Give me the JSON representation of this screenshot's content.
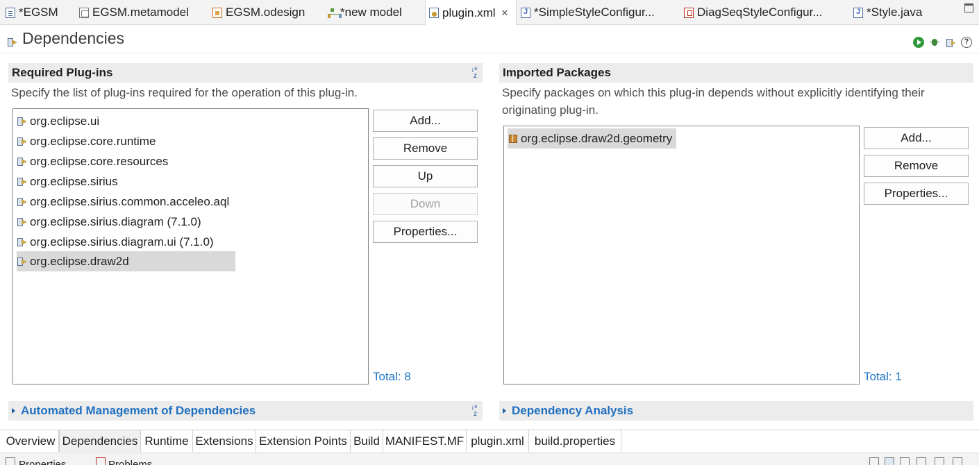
{
  "editor_tabs": [
    {
      "label": "*EGSM",
      "icon": "model-file-icon",
      "active": false
    },
    {
      "label": "EGSM.metamodel",
      "icon": "metamodel-file-icon",
      "active": false
    },
    {
      "label": "EGSM.odesign",
      "icon": "odesign-file-icon",
      "active": false
    },
    {
      "label": "*new model",
      "icon": "model-tree-icon",
      "active": false
    },
    {
      "label": "plugin.xml",
      "icon": "plugin-xml-icon",
      "active": true,
      "close": "✕"
    },
    {
      "label": "*SimpleStyleConfigur...",
      "icon": "java-file-icon",
      "active": false
    },
    {
      "label": "DiagSeqStyleConfigur...",
      "icon": "java-error-file-icon",
      "active": false
    },
    {
      "label": "*Style.java",
      "icon": "java-file-icon",
      "active": false
    }
  ],
  "header": {
    "title": "Dependencies",
    "tools": [
      "run-icon",
      "debug-icon",
      "export-icon",
      "help-icon"
    ]
  },
  "required_plugins": {
    "title": "Required Plug-ins",
    "description": "Specify the list of plug-ins required for the operation of this plug-in.",
    "items": [
      {
        "label": "org.eclipse.ui"
      },
      {
        "label": "org.eclipse.core.runtime"
      },
      {
        "label": "org.eclipse.core.resources"
      },
      {
        "label": "org.eclipse.sirius"
      },
      {
        "label": "org.eclipse.sirius.common.acceleo.aql"
      },
      {
        "label": "org.eclipse.sirius.diagram (7.1.0)"
      },
      {
        "label": "org.eclipse.sirius.diagram.ui (7.1.0)"
      },
      {
        "label": "org.eclipse.draw2d",
        "selected": true
      }
    ],
    "buttons": {
      "add": "Add...",
      "remove": "Remove",
      "up": "Up",
      "down": "Down",
      "properties": "Properties..."
    },
    "total": "Total: 8"
  },
  "imported_packages": {
    "title": "Imported Packages",
    "description_line1": "Specify packages on which this plug-in depends without explicitly identifying their",
    "description_line2": "originating plug-in.",
    "items": [
      {
        "label": "org.eclipse.draw2d.geometry",
        "selected": true
      }
    ],
    "buttons": {
      "add": "Add...",
      "remove": "Remove",
      "properties": "Properties..."
    },
    "total": "Total: 1"
  },
  "automated_management": {
    "title": "Automated Management of Dependencies"
  },
  "dependency_analysis": {
    "title": "Dependency Analysis"
  },
  "page_tabs": [
    {
      "label": "Overview"
    },
    {
      "label": "Dependencies",
      "active": true
    },
    {
      "label": "Runtime"
    },
    {
      "label": "Extensions"
    },
    {
      "label": "Extension Points"
    },
    {
      "label": "Build"
    },
    {
      "label": "MANIFEST.MF"
    },
    {
      "label": "plugin.xml"
    },
    {
      "label": "build.properties"
    }
  ],
  "bottom_views": {
    "properties": "Properties",
    "problems": "Problems"
  },
  "colors": {
    "link": "#1f6fbf",
    "section_header_bg": "#ececec",
    "selection_bg": "#d9d9d9"
  }
}
